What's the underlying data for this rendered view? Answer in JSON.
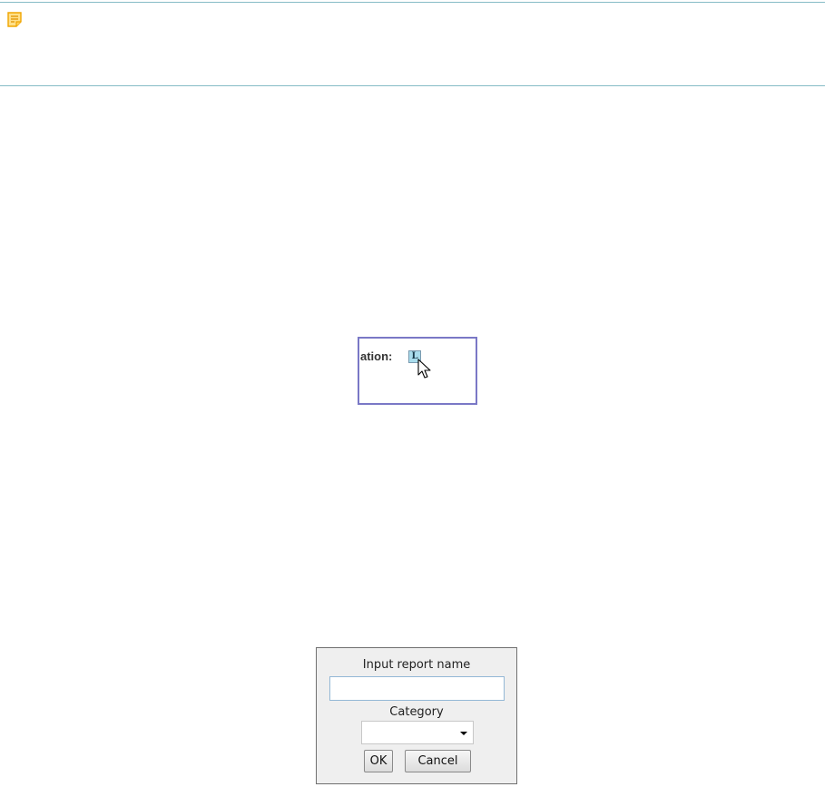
{
  "note": {
    "icon": "note-icon"
  },
  "screenshot_toolbar": {
    "label": "ation:",
    "tool_button": {
      "glyph": "L",
      "icon": "label-tool-icon"
    },
    "cursor": "arrow-cursor-icon"
  },
  "screenshot_dialog": {
    "title": "Input report name",
    "name_input": {
      "value": "",
      "placeholder": ""
    },
    "category_label": "Category",
    "category_select": {
      "selected": ""
    },
    "ok_label": "OK",
    "cancel_label": "Cancel"
  },
  "colors": {
    "divider": "#86bcc6",
    "note_icon": "#f5b400",
    "crop_border": "#7a78c6",
    "tool_button_bg": "#a9dcec",
    "input_border": "#94b8d6"
  }
}
